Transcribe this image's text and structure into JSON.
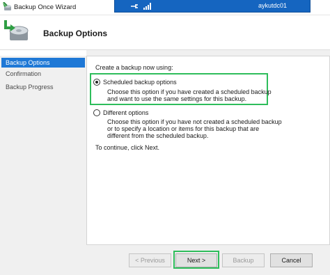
{
  "window": {
    "title": "Backup Once Wizard",
    "icon": "backup-wizard-icon"
  },
  "remote_bar": {
    "host": "aykutdc01",
    "pin_icon": "pin-icon",
    "signal_icon": "signal-bars-icon",
    "color": "#1565c0"
  },
  "header": {
    "title": "Backup Options",
    "icon": "backup-disk-icon"
  },
  "sidebar": {
    "items": [
      {
        "label": "Backup Options",
        "active": true
      },
      {
        "label": "Confirmation",
        "active": false
      },
      {
        "label": "Backup Progress",
        "active": false
      }
    ],
    "active_color": "#1e78d6"
  },
  "main": {
    "prompt": "Create a backup now using:",
    "options": [
      {
        "label": "Scheduled backup options",
        "selected": true,
        "description": [
          "Choose this option if you have created a scheduled backup",
          "and want to use the same settings for this backup."
        ]
      },
      {
        "label": "Different options",
        "selected": false,
        "description": [
          "Choose this option if you have not created a scheduled backup",
          "or to specify a location or items for this backup that are",
          "different from the scheduled backup."
        ]
      }
    ],
    "continue_text": "To continue, click Next.",
    "highlight_color": "#2ebd5b"
  },
  "buttons": {
    "previous": "< Previous",
    "next": "Next >",
    "backup": "Backup",
    "cancel": "Cancel"
  }
}
